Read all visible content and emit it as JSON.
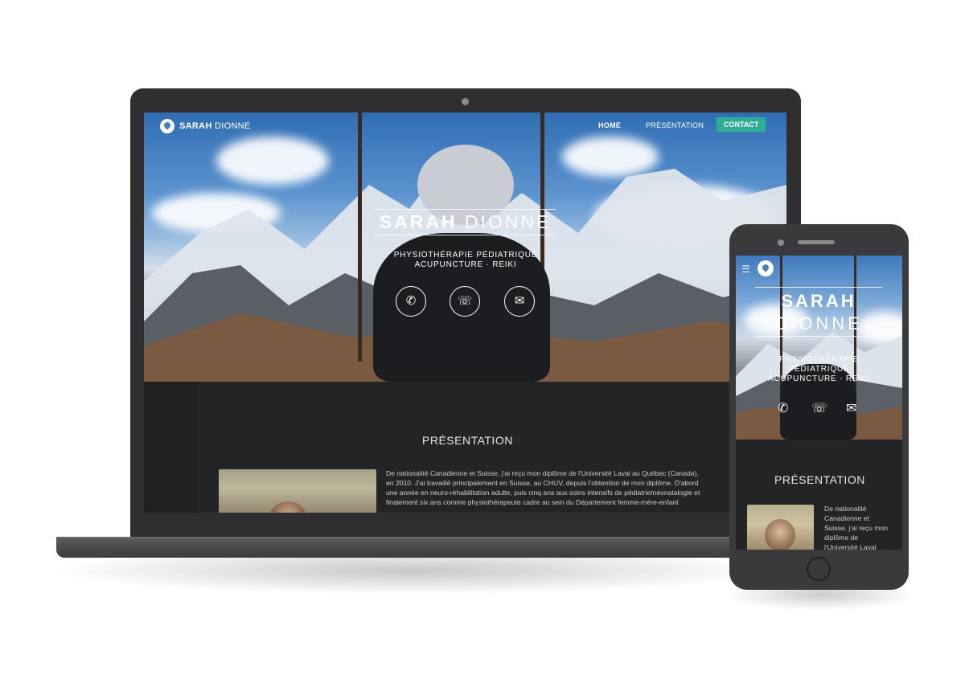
{
  "desktop": {
    "brand": {
      "first": "SARAH",
      "last": "DIONNE"
    },
    "nav": {
      "home": "HOME",
      "presentation": "PRÉSENTATION",
      "contact": "CONTACT"
    },
    "hero": {
      "title_first": "SARAH",
      "title_last": "DIONNE",
      "subtitle_line1": "PHYSIOTHÉRAPIE PÉDIATRIQUE",
      "subtitle_line2": "ACUPUNCTURE · REIKI"
    },
    "icons": {
      "phone": "phone-icon",
      "whatsapp": "whatsapp-icon",
      "email": "email-icon"
    },
    "presentation": {
      "title": "PRÉSENTATION",
      "text": "De nationalité Canadienne et Suisse, j'ai reçu mon diplôme de l'Université Laval au Québec (Canada), en 2010. J'ai travaillé principalement en Suisse, au CHUV, depuis l'obtention de mon diplôme. D'abord une année en neuro-réhabilitation adulte, puis cinq ans aux soins intensifs de pédiatrie/néonatalogie et finalement six ans comme physiothérapeute cadre au sein du Département femme-mère-enfant"
    }
  },
  "mobile": {
    "hero": {
      "title_first": "SARAH",
      "title_last": "DIONNE",
      "subtitle_line1": "PHYSIOTHÉRAPIE",
      "subtitle_line2": "PÉDIATRIQUE",
      "subtitle_line3": "ACUPUNCTURE · REIKI"
    },
    "presentation": {
      "title": "PRÉSENTATION",
      "text": "De nationalité Canadienne et Suisse, j'ai reçu mon diplôme de l'Université Laval"
    }
  },
  "colors": {
    "accent": "#2fae96",
    "dark_bg": "#222426",
    "device": "#2f2f31"
  }
}
